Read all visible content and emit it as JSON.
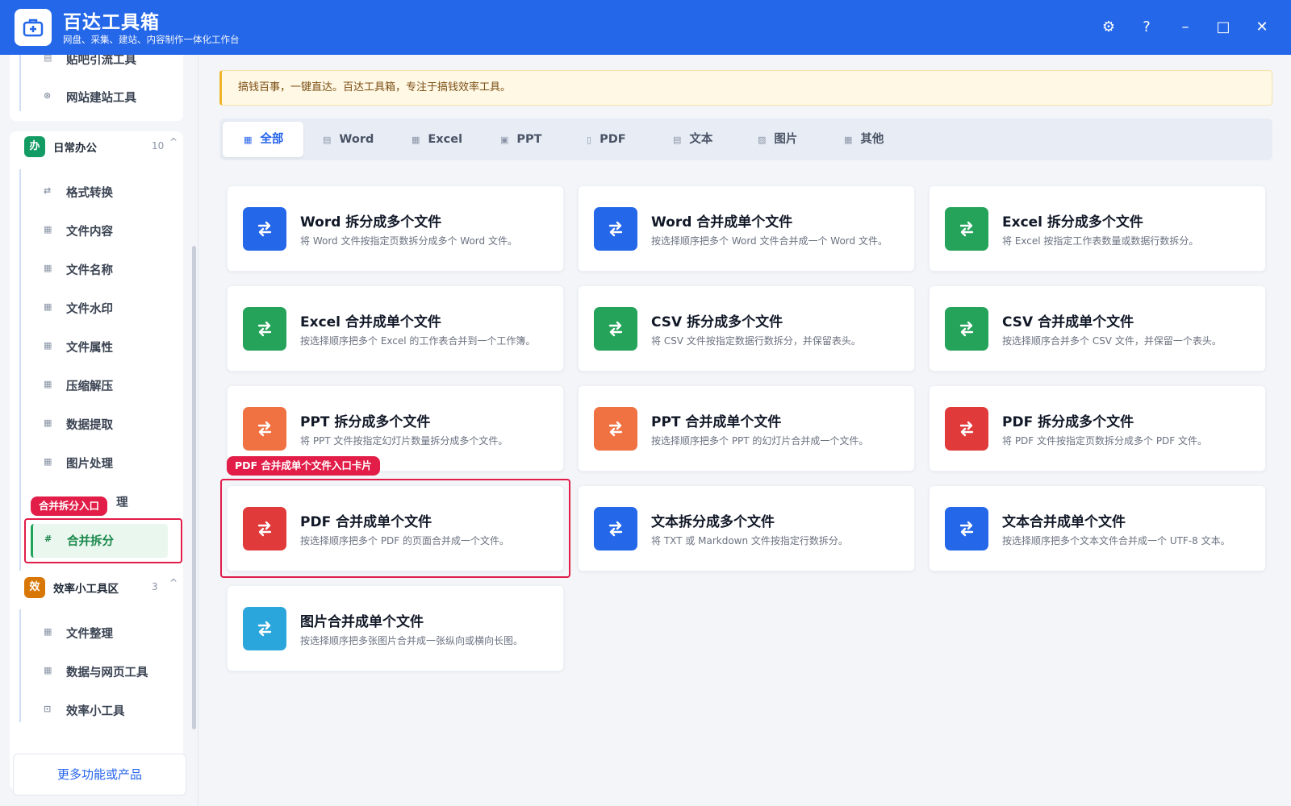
{
  "titlebar": {
    "title": "百达工具箱",
    "subtitle": "网盘、采集、建站、内容制作一体化工作台",
    "buttons": {
      "settings": "⚙",
      "help": "?",
      "minimize": "–",
      "maximize": "□",
      "close": "✕"
    }
  },
  "sidebar": {
    "top_items": [
      {
        "label": "贴吧引流工具",
        "icon": "doc-icon"
      },
      {
        "label": "网站建站工具",
        "icon": "globe-icon"
      }
    ],
    "groups": [
      {
        "badge": "办",
        "badge_color": "#129b63",
        "title": "日常办公",
        "count": "10",
        "chevron": "^",
        "items": [
          {
            "label": "格式转换",
            "icon": "swap-icon"
          },
          {
            "label": "文件内容",
            "icon": "grid-icon"
          },
          {
            "label": "文件名称",
            "icon": "grid-icon"
          },
          {
            "label": "文件水印",
            "icon": "grid-icon"
          },
          {
            "label": "文件属性",
            "icon": "grid-icon"
          },
          {
            "label": "压缩解压",
            "icon": "grid-icon"
          },
          {
            "label": "数据提取",
            "icon": "grid-icon"
          },
          {
            "label": "图片处理",
            "icon": "grid-icon"
          },
          {
            "label": "理",
            "icon": "grid-icon"
          },
          {
            "label": "合并拆分",
            "icon": "hash-icon"
          }
        ]
      },
      {
        "badge": "效",
        "badge_color": "#d97706",
        "title": "效率小工具区",
        "count": "3",
        "chevron": "^",
        "items": [
          {
            "label": "文件整理",
            "icon": "grid-icon"
          },
          {
            "label": "数据与网页工具",
            "icon": "grid-icon"
          },
          {
            "label": "效率小工具",
            "icon": "toolbox-icon"
          }
        ]
      }
    ],
    "highlight_tag": "合并拆分入口",
    "more_button": "更多功能或产品"
  },
  "notice": "搞钱百事，一键直达。百达工具箱，专注于搞钱效率工具。",
  "tabs": [
    {
      "label": "全部",
      "active": true
    },
    {
      "label": "Word"
    },
    {
      "label": "Excel"
    },
    {
      "label": "PPT"
    },
    {
      "label": "PDF"
    },
    {
      "label": "文本"
    },
    {
      "label": "图片"
    },
    {
      "label": "其他"
    }
  ],
  "cards": [
    {
      "title": "Word 拆分成多个文件",
      "desc": "将 Word 文件按指定页数拆分成多个 Word 文件。",
      "color": "#2467e8"
    },
    {
      "title": "Word 合并成单个文件",
      "desc": "按选择顺序把多个 Word 文件合并成一个 Word 文件。",
      "color": "#2467e8"
    },
    {
      "title": "Excel 拆分成多个文件",
      "desc": "将 Excel 按指定工作表数量或数据行数拆分。",
      "color": "#25a35a"
    },
    {
      "title": "Excel 合并成单个文件",
      "desc": "按选择顺序把多个 Excel 的工作表合并到一个工作簿。",
      "color": "#25a35a"
    },
    {
      "title": "CSV 拆分成多个文件",
      "desc": "将 CSV 文件按指定数据行数拆分，并保留表头。",
      "color": "#25a35a"
    },
    {
      "title": "CSV 合并成单个文件",
      "desc": "按选择顺序合并多个 CSV 文件，并保留一个表头。",
      "color": "#25a35a"
    },
    {
      "title": "PPT 拆分成多个文件",
      "desc": "将 PPT 文件按指定幻灯片数量拆分成多个文件。",
      "color": "#f07142"
    },
    {
      "title": "PPT 合并成单个文件",
      "desc": "按选择顺序把多个 PPT 的幻灯片合并成一个文件。",
      "color": "#f07142"
    },
    {
      "title": "PDF 拆分成多个文件",
      "desc": "将 PDF 文件按指定页数拆分成多个 PDF 文件。",
      "color": "#e03a3a"
    },
    {
      "title": "PDF 合并成单个文件",
      "desc": "按选择顺序把多个 PDF 的页面合并成一个文件。",
      "color": "#e03a3a"
    },
    {
      "title": "文本拆分成多个文件",
      "desc": "将 TXT 或 Markdown 文件按指定行数拆分。",
      "color": "#2467e8"
    },
    {
      "title": "文本合并成单个文件",
      "desc": "按选择顺序把多个文本文件合并成一个 UTF-8 文本。",
      "color": "#2467e8"
    },
    {
      "title": "图片合并成单个文件",
      "desc": "按选择顺序把多张图片合并成一张纵向或横向长图。",
      "color": "#2ba6dc"
    }
  ],
  "card_highlight_tag": "PDF 合并成单个文件入口卡片"
}
